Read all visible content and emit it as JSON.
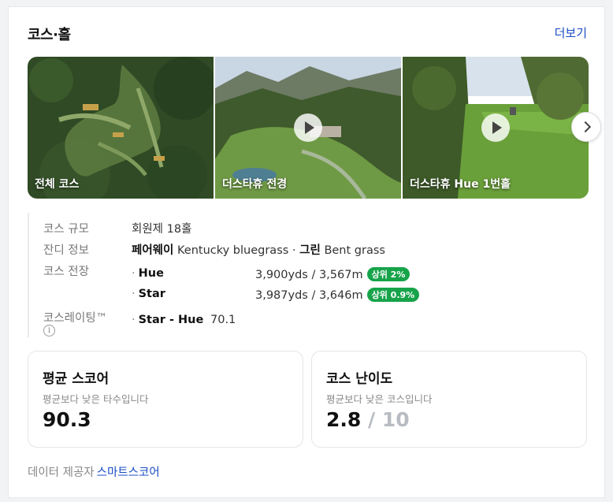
{
  "section": {
    "title": "코스·홀",
    "more_label": "더보기"
  },
  "gallery": {
    "tiles": [
      {
        "label": "전체 코스",
        "has_play": false
      },
      {
        "label": "더스타휴 전경",
        "has_play": true
      },
      {
        "label": "더스타휴 Hue 1번홀",
        "has_play": true
      }
    ],
    "next_icon": "chevron-right-icon"
  },
  "info": {
    "scale_label": "코스 규모",
    "scale_value": "회원제 18홀",
    "grass_label": "잔디 정보",
    "fairway_label": "페어웨이",
    "fairway_value": "Kentucky bluegrass",
    "separator": "·",
    "green_label": "그린",
    "green_value": "Bent grass",
    "length_label": "코스 전장",
    "lengths": [
      {
        "name": "Hue",
        "value": "3,900yds / 3,567m",
        "badge": "상위 2%"
      },
      {
        "name": "Star",
        "value": "3,987yds / 3,646m",
        "badge": "상위 0.9%"
      }
    ],
    "rating_label": "코스레이팅™",
    "rating_name": "Star - Hue",
    "rating_value": "70.1",
    "info_icon": "i"
  },
  "stats": {
    "avg_score": {
      "title": "평균 스코어",
      "sub": "평균보다 낮은 타수입니다",
      "value": "90.3"
    },
    "difficulty": {
      "title": "코스 난이도",
      "sub": "평균보다 낮은 코스입니다",
      "value": "2.8",
      "max": "/ 10"
    }
  },
  "footer": {
    "provider_label": "데이터 제공자",
    "provider_name": "스마트스코어"
  },
  "colors": {
    "link": "#1a4cc4",
    "badge_green": "#17a34a"
  }
}
